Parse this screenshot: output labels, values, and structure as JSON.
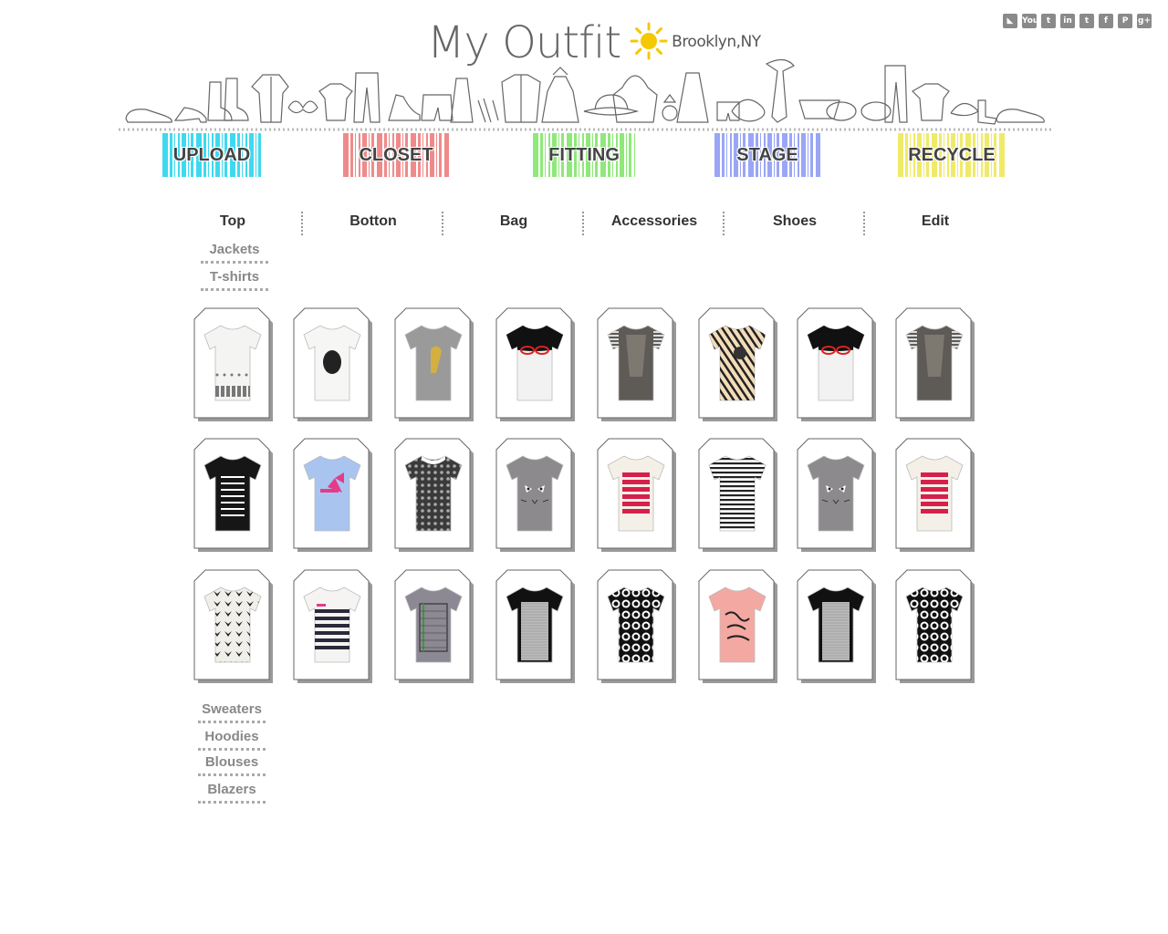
{
  "header": {
    "title": "My Outfit",
    "location": "Brooklyn,NY",
    "weather_icon": "sun-icon",
    "sun_color": "#f5c800"
  },
  "social": [
    {
      "name": "rss-icon",
      "glyph": "◣"
    },
    {
      "name": "youtube-icon",
      "glyph": "You"
    },
    {
      "name": "tumblr-icon",
      "glyph": "t"
    },
    {
      "name": "linkedin-icon",
      "glyph": "in"
    },
    {
      "name": "twitter-icon",
      "glyph": "t"
    },
    {
      "name": "facebook-icon",
      "glyph": "f"
    },
    {
      "name": "pinterest-icon",
      "glyph": "P"
    },
    {
      "name": "googleplus-icon",
      "glyph": "g+"
    }
  ],
  "nav": [
    {
      "label": "UPLOAD",
      "color": "#3fd9ef"
    },
    {
      "label": "CLOSET",
      "color": "#f08a8a"
    },
    {
      "label": "FITTING",
      "color": "#8fe87a"
    },
    {
      "label": "STAGE",
      "color": "#9aa6f5"
    },
    {
      "label": "RECYCLE",
      "color": "#f0ea6a"
    }
  ],
  "categories": [
    "Top",
    "Botton",
    "Bag",
    "Accessories",
    "Shoes",
    "Edit"
  ],
  "subcategories_top": [
    "Jackets",
    "T-shirts"
  ],
  "subcategories_bottom": [
    "Sweaters",
    "Hoodies",
    "Blouses",
    "Blazers"
  ],
  "products": [
    {
      "body": "#f4f4f2",
      "pattern": "bottom-print",
      "accent": "#777"
    },
    {
      "body": "#f6f6f4",
      "pattern": "cameo",
      "accent": "#222"
    },
    {
      "body": "#9a9a9a",
      "pattern": "figure",
      "accent": "#d4b040"
    },
    {
      "body": "#f2f2f2",
      "pattern": "glasses",
      "accent": "#d22"
    },
    {
      "body": "#5e5a56",
      "pattern": "stripe-sleeve",
      "accent": "#ddd"
    },
    {
      "body": "#f3ddb8",
      "pattern": "diagonal",
      "accent": "#222"
    },
    {
      "body": "#f2f2f2",
      "pattern": "glasses",
      "accent": "#d22"
    },
    {
      "body": "#5e5a56",
      "pattern": "stripe-sleeve",
      "accent": "#ddd"
    },
    {
      "body": "#161616",
      "pattern": "text",
      "accent": "#fff"
    },
    {
      "body": "#a9c4ef",
      "pattern": "bow",
      "accent": "#e33c8a"
    },
    {
      "body": "#3a3a3a",
      "pattern": "dots",
      "accent": "#aaa"
    },
    {
      "body": "#8d8a8e",
      "pattern": "cat",
      "accent": "#222"
    },
    {
      "body": "#f4f0e8",
      "pattern": "redtext",
      "accent": "#d6204a"
    },
    {
      "body": "#ffffff",
      "pattern": "hstripes",
      "accent": "#222"
    },
    {
      "body": "#8d8a8e",
      "pattern": "cat",
      "accent": "#222"
    },
    {
      "body": "#f4f0e8",
      "pattern": "redtext",
      "accent": "#d6204a"
    },
    {
      "body": "#f0efea",
      "pattern": "birds",
      "accent": "#222"
    },
    {
      "body": "#f6f4f2",
      "pattern": "bands",
      "accent": "#2a2a3a"
    },
    {
      "body": "#8c8894",
      "pattern": "grid",
      "accent": "#3c9a3c"
    },
    {
      "body": "#111111",
      "pattern": "panel",
      "accent": "#bbb"
    },
    {
      "body": "#111111",
      "pattern": "cameos",
      "accent": "#fff"
    },
    {
      "body": "#f4a8a2",
      "pattern": "script",
      "accent": "#222"
    },
    {
      "body": "#111111",
      "pattern": "panel",
      "accent": "#bbb"
    },
    {
      "body": "#111111",
      "pattern": "cameos",
      "accent": "#fff"
    }
  ]
}
